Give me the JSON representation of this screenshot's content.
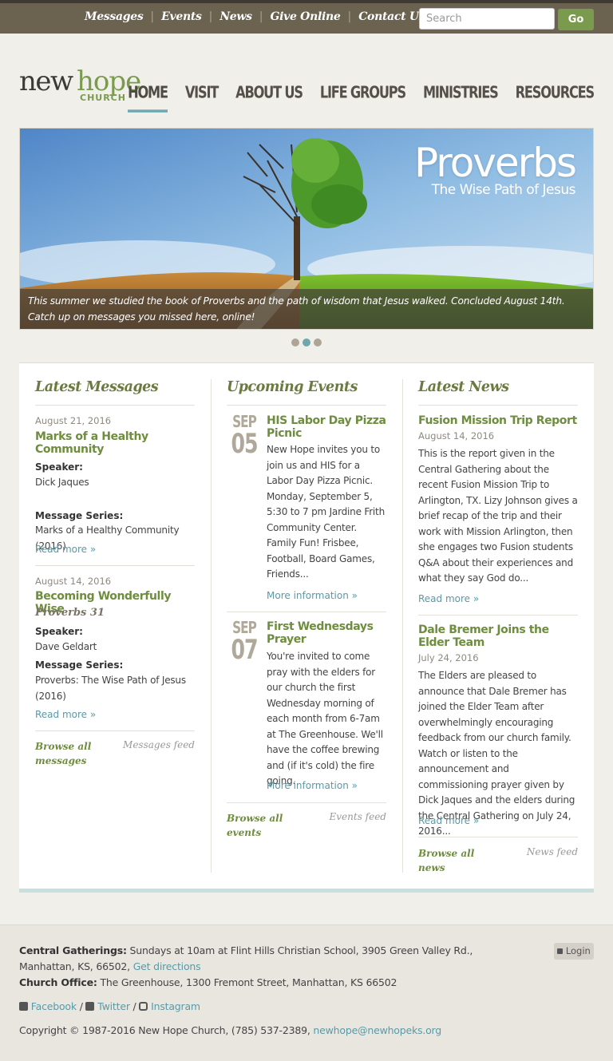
{
  "topnav": {
    "links": [
      "Messages",
      "Events",
      "News",
      "Give Online",
      "Contact Us"
    ],
    "search_placeholder": "Search",
    "go_label": "Go"
  },
  "logo": {
    "new": "new",
    "hope": "hope",
    "church": "CHURCH"
  },
  "mainnav": [
    "HOME",
    "VISIT",
    "ABOUT US",
    "LIFE GROUPS",
    "MINISTRIES",
    "RESOURCES"
  ],
  "hero": {
    "title": "Proverbs",
    "subtitle": "The Wise Path of Jesus",
    "caption": "This summer we studied the book of Proverbs and the path of wisdom that Jesus walked. Concluded August 14th. Catch up on messages you missed here, online!",
    "slide_count": 3,
    "active_slide": 1
  },
  "messages": {
    "heading": "Latest Messages",
    "items": [
      {
        "date": "August 21, 2016",
        "title": "Marks of a Healthy Community",
        "speaker_label": "Speaker:",
        "speaker": "Dick Jaques",
        "series_label": "Message Series:",
        "series": "Marks of a Healthy Community (2016)",
        "read_more": "Read more »"
      },
      {
        "date": "August 14, 2016",
        "title": "Becoming Wonderfully Wise",
        "passage": "Proverbs 31",
        "speaker_label": "Speaker:",
        "speaker": "Dave Geldart",
        "series_label": "Message Series:",
        "series": "Proverbs: The Wise Path of Jesus (2016)",
        "read_more": "Read more »"
      }
    ],
    "browse": "Browse all messages",
    "feed": "Messages feed"
  },
  "events": {
    "heading": "Upcoming Events",
    "items": [
      {
        "month": "SEP",
        "day": "05",
        "title": "HIS Labor Day Pizza Picnic",
        "body": "New Hope invites you to join us and HIS for a Labor Day Pizza Picnic.  Monday, September 5, 5:30 to 7 pm Jardine Frith Community Center.  Family Fun!  Frisbee, Football, Board Games, Friends...",
        "more": "More information »"
      },
      {
        "month": "SEP",
        "day": "07",
        "title": "First Wednesdays Prayer",
        "body": "You're invited to come pray with the elders for our church the first Wednesday morning of each month from 6-7am at The Greenhouse.  We'll have the coffee brewing and (if it's cold) the fire going.",
        "more": "More information »"
      }
    ],
    "browse": "Browse all events",
    "feed": "Events feed"
  },
  "news": {
    "heading": "Latest News",
    "items": [
      {
        "title": "Fusion Mission Trip Report",
        "date": "August 14, 2016",
        "body": "This is the report given in the Central Gathering about the recent Fusion Mission Trip to Arlington, TX.  Lizy Johnson gives a brief recap of the trip and their work with Mission Arlington, then she engages two Fusion students Q&A about their experiences and what they say God do...",
        "read_more": "Read more »"
      },
      {
        "title": "Dale Bremer Joins the Elder Team",
        "date": "July 24, 2016",
        "body": "The Elders are pleased to announce that Dale Bremer has joined the Elder Team after overwhelmingly encouraging feedback from our church family.  Watch or listen to the announcement and commissioning prayer given by Dick Jaques and the elders during the Central Gathering on July 24, 2016...",
        "read_more": "Read more »"
      }
    ],
    "browse": "Browse all news",
    "feed": "News feed"
  },
  "footer": {
    "gatherings_label": "Central Gatherings:",
    "gatherings": "Sundays at 10am at Flint Hills Christian School, 3905 Green Valley Rd.,",
    "gatherings2": "Manhattan, KS, 66502,",
    "directions": "Get directions",
    "office_label": "Church Office:",
    "office": "The Greenhouse, 1300 Fremont Street, Manhattan, KS 66502",
    "facebook": "Facebook",
    "twitter": "Twitter",
    "instagram": "Instagram",
    "copyright": "Copyright © 1987-2016 New Hope Church, (785) 537-2389,",
    "email": "newhope@newhopeks.org",
    "login": "Login"
  },
  "colors": {
    "green": "#6e8d3e",
    "teal": "#5a9aa6",
    "topbar": "#6b6250"
  }
}
